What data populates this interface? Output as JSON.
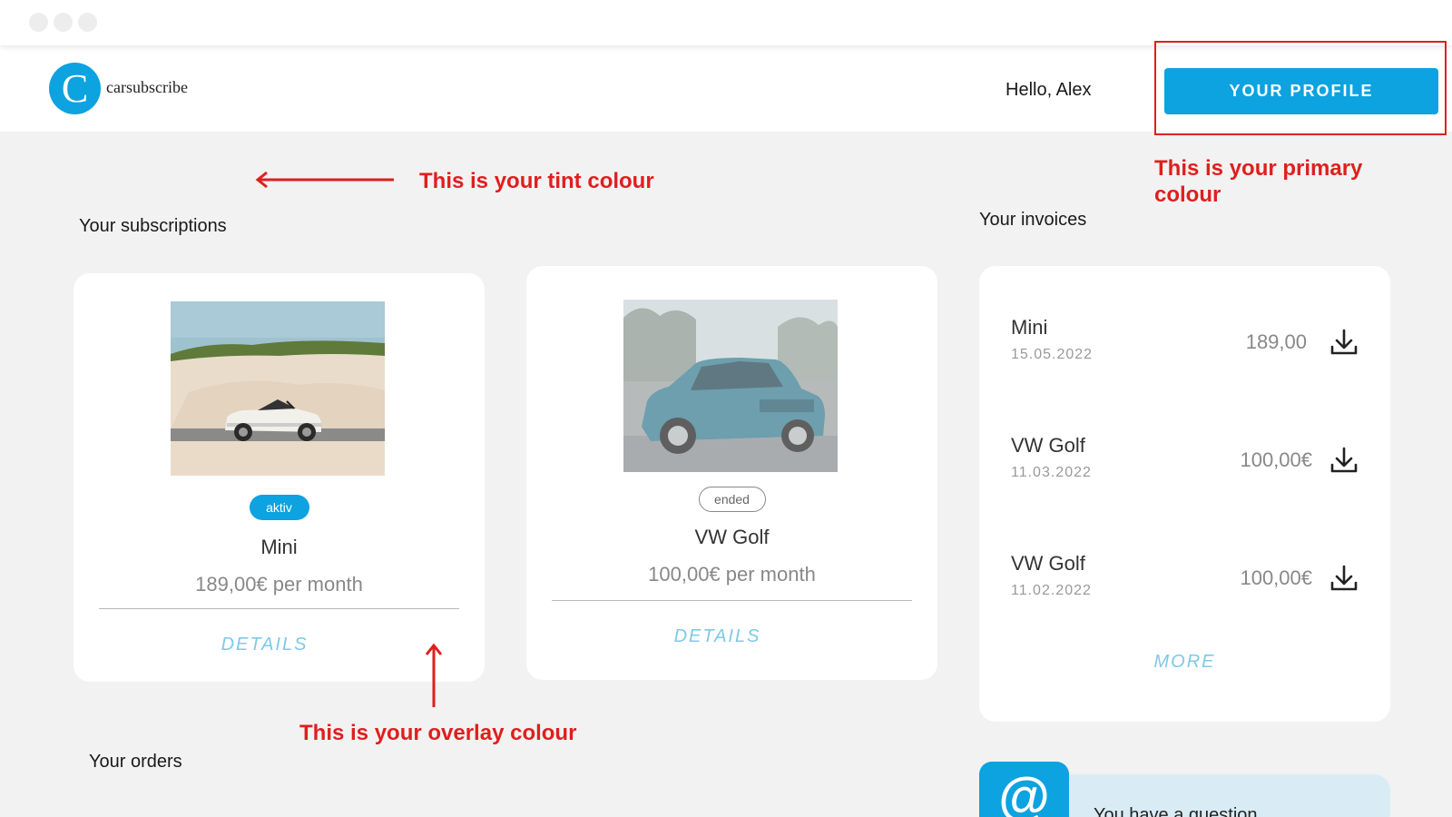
{
  "header": {
    "logo_letter": "C",
    "logo_text": "carsubscribe",
    "greeting": "Hello, Alex",
    "profile_button": "YOUR PROFILE"
  },
  "annotations": {
    "tint": "This is your tint colour",
    "primary": "This is your primary colour",
    "overlay": "This is your overlay colour"
  },
  "sections": {
    "subscriptions": "Your subscriptions",
    "invoices": "Your invoices",
    "orders": "Your orders"
  },
  "subscriptions": [
    {
      "status": "aktiv",
      "name": "Mini",
      "price": "189,00€ per month",
      "details": "DETAILS"
    },
    {
      "status": "ended",
      "name": "VW Golf",
      "price": "100,00€ per month",
      "details": "DETAILS"
    }
  ],
  "invoices": {
    "rows": [
      {
        "name": "Mini",
        "date": "15.05.2022",
        "amount": "189,00"
      },
      {
        "name": "VW Golf",
        "date": "11.03.2022",
        "amount": "100,00€"
      },
      {
        "name": "VW Golf",
        "date": "11.02.2022",
        "amount": "100,00€"
      }
    ],
    "more": "MORE"
  },
  "contact": {
    "icon_glyph": "@",
    "text": "You have a question"
  },
  "colors": {
    "primary": "#0da2e0",
    "tint": "#f2f2f2",
    "overlay": "#ffffff",
    "annotation": "#e01e1e"
  }
}
